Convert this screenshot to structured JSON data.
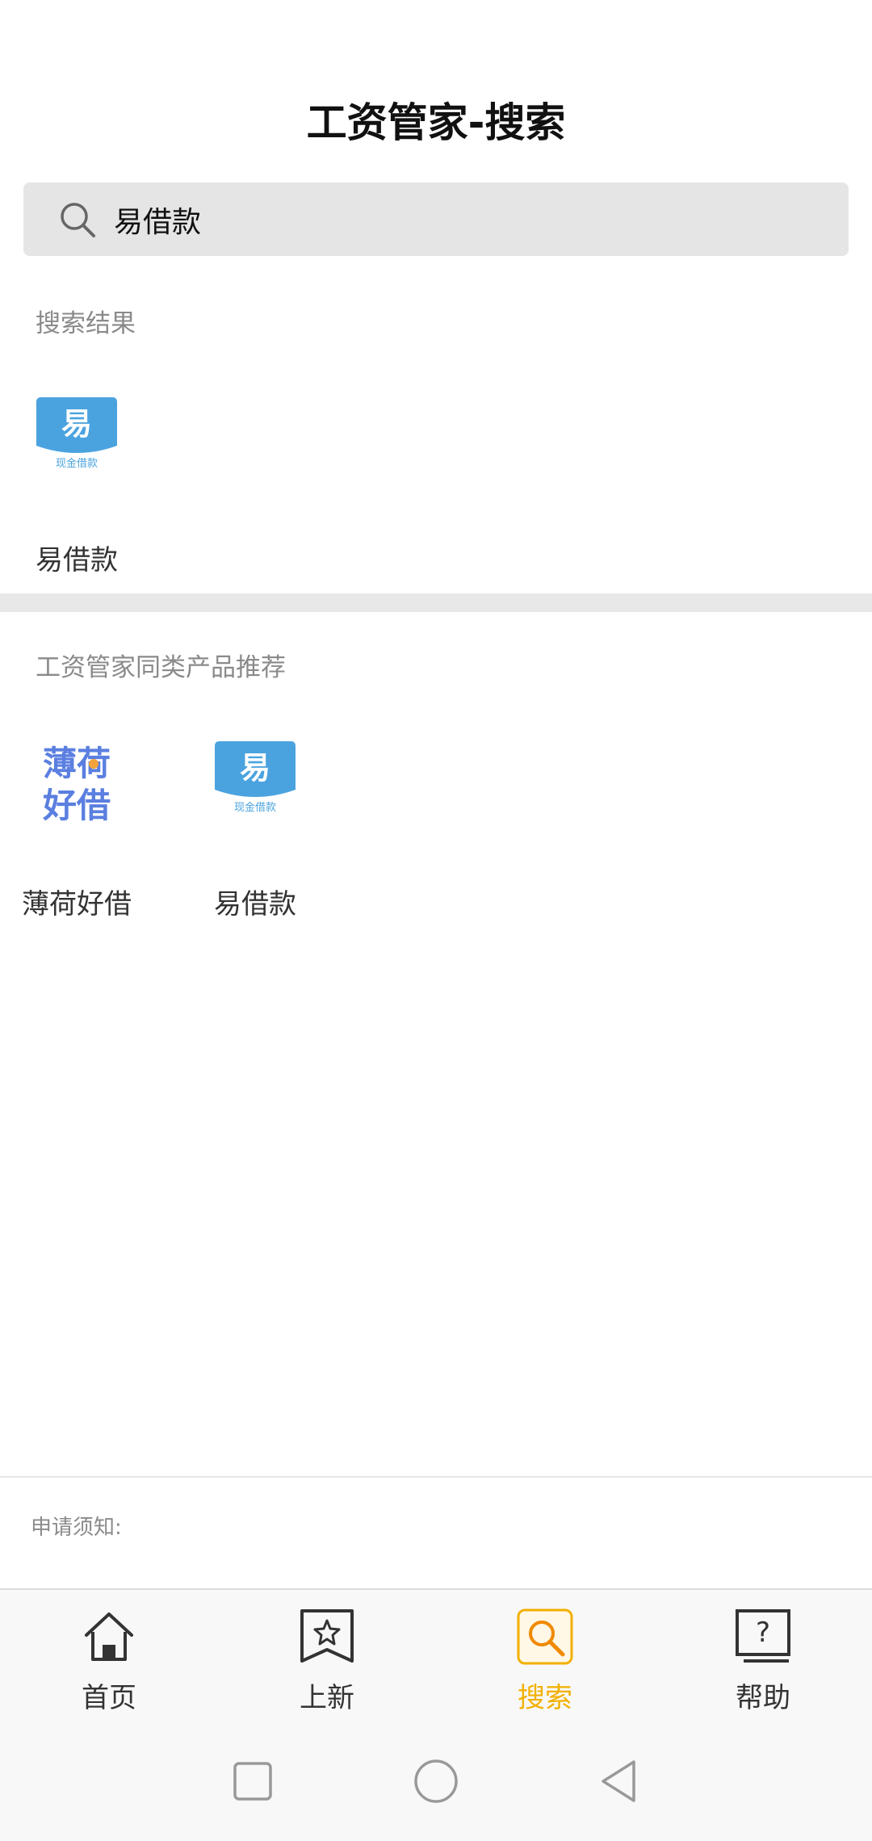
{
  "header": {
    "title": "工资管家-搜索"
  },
  "search": {
    "query": "易借款"
  },
  "results": {
    "label": "搜索结果",
    "items": [
      {
        "name": "易借款",
        "logo_char": "易",
        "logo_sub": "现金借款"
      }
    ]
  },
  "recommend": {
    "label": "工资管家同类产品推荐",
    "items": [
      {
        "name": "薄荷好借",
        "logo_line1": "薄荷",
        "logo_line2": "好借"
      },
      {
        "name": "易借款",
        "logo_char": "易",
        "logo_sub": "现金借款"
      }
    ]
  },
  "notice": {
    "label": "申请须知:"
  },
  "tabbar": {
    "items": [
      {
        "label": "首页",
        "icon": "home-icon"
      },
      {
        "label": "上新",
        "icon": "star-bookmark-icon"
      },
      {
        "label": "搜索",
        "icon": "search-icon",
        "active": true
      },
      {
        "label": "帮助",
        "icon": "help-icon"
      }
    ]
  },
  "colors": {
    "accent": "#f2b000",
    "logo_blue": "#4aa3df",
    "mint_blue": "#5b7fe0"
  }
}
